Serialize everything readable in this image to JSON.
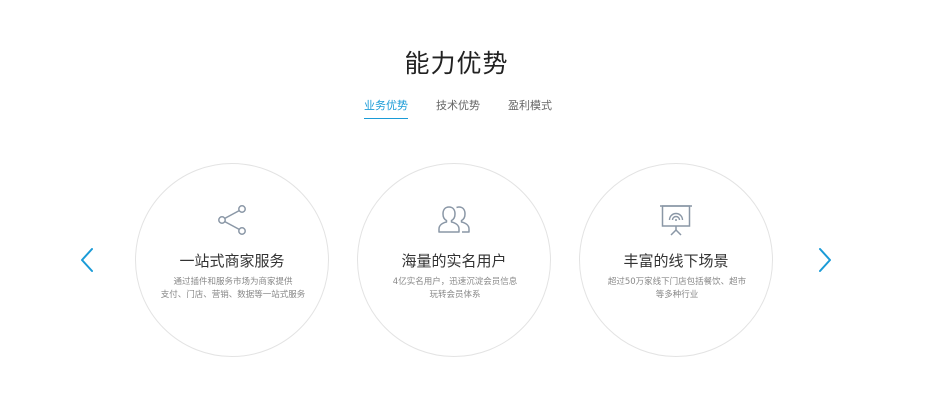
{
  "section": {
    "title": "能力优势"
  },
  "tabs": [
    {
      "label": "业务优势",
      "active": true
    },
    {
      "label": "技术优势",
      "active": false
    },
    {
      "label": "盈利模式",
      "active": false
    }
  ],
  "carousel": {
    "prev_icon": "chevron-left-icon",
    "next_icon": "chevron-right-icon",
    "accent_color": "#1a9bd7"
  },
  "cards": [
    {
      "icon": "share-icon",
      "title": "一站式商家服务",
      "desc_line1": "通过插件和服务市场为商家提供",
      "desc_line2": "支付、门店、营销、数据等一站式服务"
    },
    {
      "icon": "users-icon",
      "title": "海量的实名用户",
      "desc_line1": "4亿实名用户，迅速沉淀会员信息",
      "desc_line2": "玩转会员体系"
    },
    {
      "icon": "presentation-icon",
      "title": "丰富的线下场景",
      "desc_line1": "超过50万家线下门店包括餐饮、超市",
      "desc_line2": "等多种行业"
    }
  ]
}
